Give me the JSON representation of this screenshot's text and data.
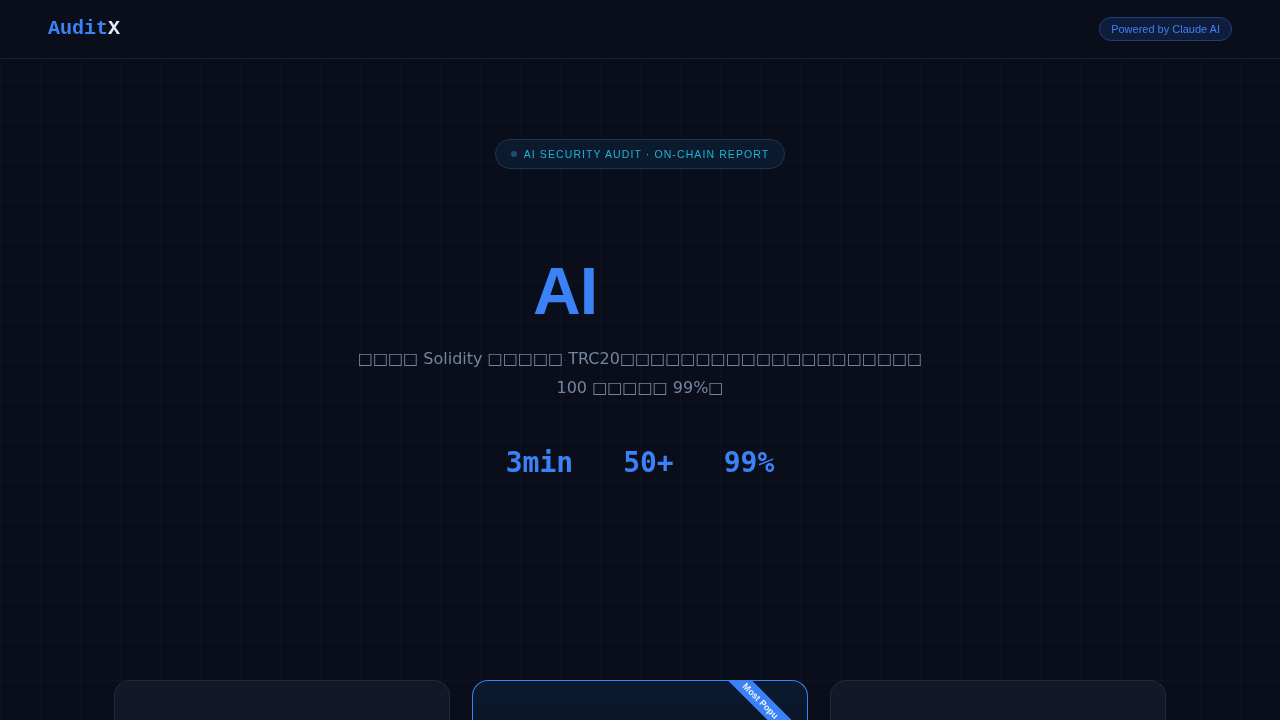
{
  "header": {
    "logo": {
      "primary": "Audit",
      "accent": "X"
    },
    "badge": "Powered by Claude AI"
  },
  "hero": {
    "tag": "AI SECURITY AUDIT · ON-CHAIN REPORT",
    "title": "AI",
    "subtitle": "□□□□ Solidity □□□□□ TRC20□□□□□□□□□□□□□□□□□□□□\n100 □□□□□ 99%□",
    "stats": [
      "3min",
      "50+",
      "99%"
    ]
  },
  "cards": [
    {
      "highlighted": false
    },
    {
      "highlighted": true,
      "ribbon": "Most Popu"
    },
    {
      "highlighted": false
    }
  ]
}
